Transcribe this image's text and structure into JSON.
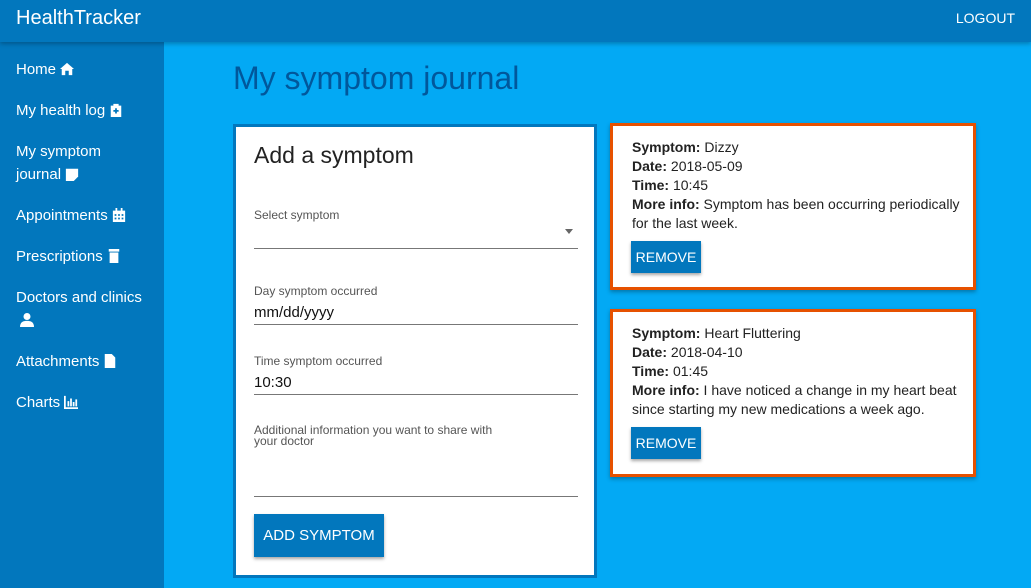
{
  "app": {
    "title": "HealthTracker",
    "logout_label": "LOGOUT"
  },
  "sidebar": {
    "items": [
      {
        "label": "Home",
        "icon": "home-icon"
      },
      {
        "label": "My health log",
        "icon": "clipboard-plus-icon"
      },
      {
        "label": "My symptom journal",
        "icon": "note-icon"
      },
      {
        "label": "Appointments",
        "icon": "calendar-icon"
      },
      {
        "label": "Prescriptions",
        "icon": "prescription-icon"
      },
      {
        "label": "Doctors and clinics",
        "icon": "doctor-icon"
      },
      {
        "label": "Attachments",
        "icon": "file-icon"
      },
      {
        "label": "Charts",
        "icon": "bar-chart-icon"
      }
    ]
  },
  "page": {
    "title": "My symptom journal"
  },
  "form": {
    "title": "Add a symptom",
    "symptom_label": "Select symptom",
    "symptom_value": "",
    "day_label": "Day symptom occurred",
    "day_value": "mm/dd/yyyy",
    "time_label": "Time symptom occurred",
    "time_value": "10:30",
    "info_label": "Additional information you want to share with your doctor",
    "info_value": "",
    "submit_label": "ADD SYMPTOM"
  },
  "entries": [
    {
      "symptom_key": "Symptom:",
      "symptom": "Dizzy",
      "date_key": "Date:",
      "date": "2018-05-09",
      "time_key": "Time:",
      "time": "10:45",
      "info_key": "More info:",
      "info": "Symptom has been occurring periodically for the last week.",
      "remove_label": "REMOVE"
    },
    {
      "symptom_key": "Symptom:",
      "symptom": "Heart Fluttering",
      "date_key": "Date:",
      "date": "2018-04-10",
      "time_key": "Time:",
      "time": "01:45",
      "info_key": "More info:",
      "info": "I have noticed a change in my heart beat since starting my new medications a week ago.",
      "remove_label": "REMOVE"
    }
  ],
  "colors": {
    "appbar": "#0277bd",
    "background": "#03a9f4",
    "form_border": "#0277bd",
    "entry_border": "#e65100",
    "title": "#01579b"
  }
}
